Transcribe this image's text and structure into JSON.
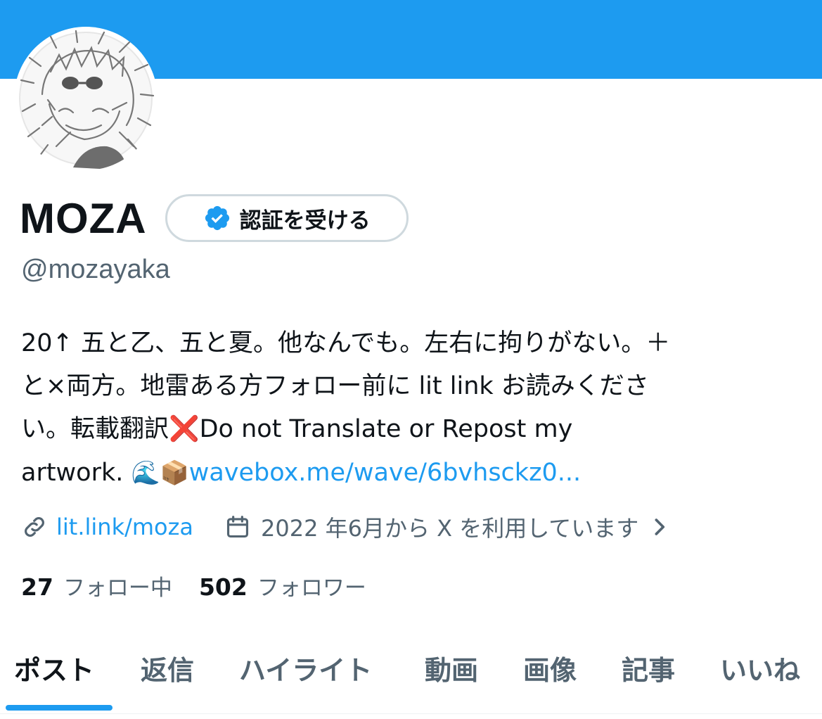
{
  "profile": {
    "display_name": "MOZA",
    "verify_label": "認証を受ける",
    "handle": "@mozayaka",
    "bio": {
      "line1": "20↑ 五と乙、五と夏。他なんでも。左右に拘りがない。＋",
      "line2": "と×両方。地雷ある方フォロー前に lit link お読みくださ",
      "line3_a": "い。転載翻訳",
      "cross_emoji": "❌",
      "line3_b": "Do not Translate or Repost my",
      "line4_a": "artwork. ",
      "wave_emoji": "🌊",
      "box_emoji": "📦",
      "link": "wavebox.me/wave/6bvhsckz0..."
    },
    "website": "lit.link/moza",
    "joined": "2022 年6月から X を利用しています",
    "following_count": "27",
    "following_label": "フォロー中",
    "followers_count": "502",
    "followers_label": "フォロワー"
  },
  "tabs": [
    {
      "label": "ポスト",
      "active": true
    },
    {
      "label": "返信",
      "active": false
    },
    {
      "label": "ハイライト",
      "active": false
    },
    {
      "label": "動画",
      "active": false
    },
    {
      "label": "画像",
      "active": false
    },
    {
      "label": "記事",
      "active": false
    },
    {
      "label": "いいね",
      "active": false
    }
  ],
  "colors": {
    "banner": "#1d9bf0",
    "accent": "#1d9bf0",
    "text": "#0f1419",
    "muted": "#536471"
  },
  "icons": {
    "verified": "verified-badge-icon",
    "link": "link-icon",
    "calendar": "calendar-icon",
    "chevron": "chevron-right-icon"
  }
}
